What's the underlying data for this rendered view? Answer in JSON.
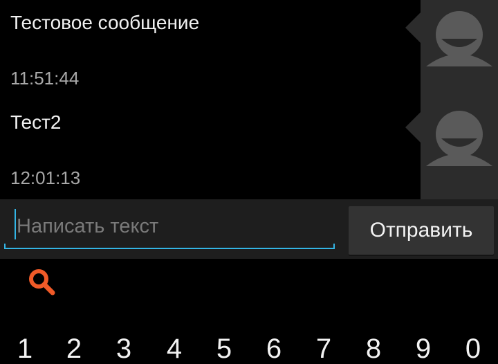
{
  "messages": [
    {
      "text": "Тестовое сообщение",
      "time": "11:51:44",
      "avatar_icon": "default-avatar-icon"
    },
    {
      "text": "Тест2",
      "time": "12:01:13",
      "avatar_icon": "default-avatar-icon"
    }
  ],
  "compose": {
    "placeholder": "Написать текст",
    "value": "",
    "send_label": "Отправить"
  },
  "keyboard": {
    "search_icon": "search-icon",
    "digits": [
      "1",
      "2",
      "3",
      "4",
      "5",
      "6",
      "7",
      "8",
      "9",
      "0"
    ]
  },
  "colors": {
    "background": "#000000",
    "accent": "#33b5e5",
    "search_icon": "#f05a28",
    "avatar_bg": "#2c2c2c",
    "avatar_fg": "#5a5a5a"
  }
}
